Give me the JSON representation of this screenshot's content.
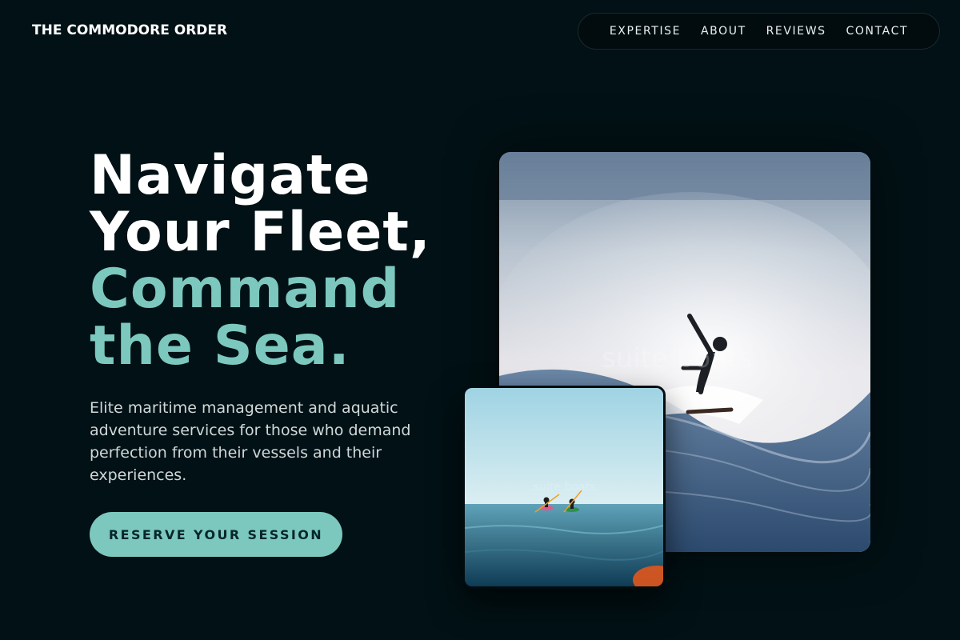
{
  "brand": "THE COMMODORE ORDER",
  "nav": {
    "items": [
      "EXPERTISE",
      "ABOUT",
      "REVIEWS",
      "CONTACT"
    ]
  },
  "hero": {
    "headline_white": [
      "Navigate",
      "Your Fleet,"
    ],
    "headline_accent": [
      "Command",
      "the Sea."
    ],
    "subtitle": "Elite maritime management and aquatic adventure services for those who demand perfection from their vessels and their experiences.",
    "cta_label": "RESERVE YOUR SESSION"
  },
  "images": {
    "main_watermark": "suite boats",
    "small_watermark": "suite boats"
  },
  "colors": {
    "background": "#021115",
    "accent": "#7cc8be",
    "text": "#ffffff"
  }
}
